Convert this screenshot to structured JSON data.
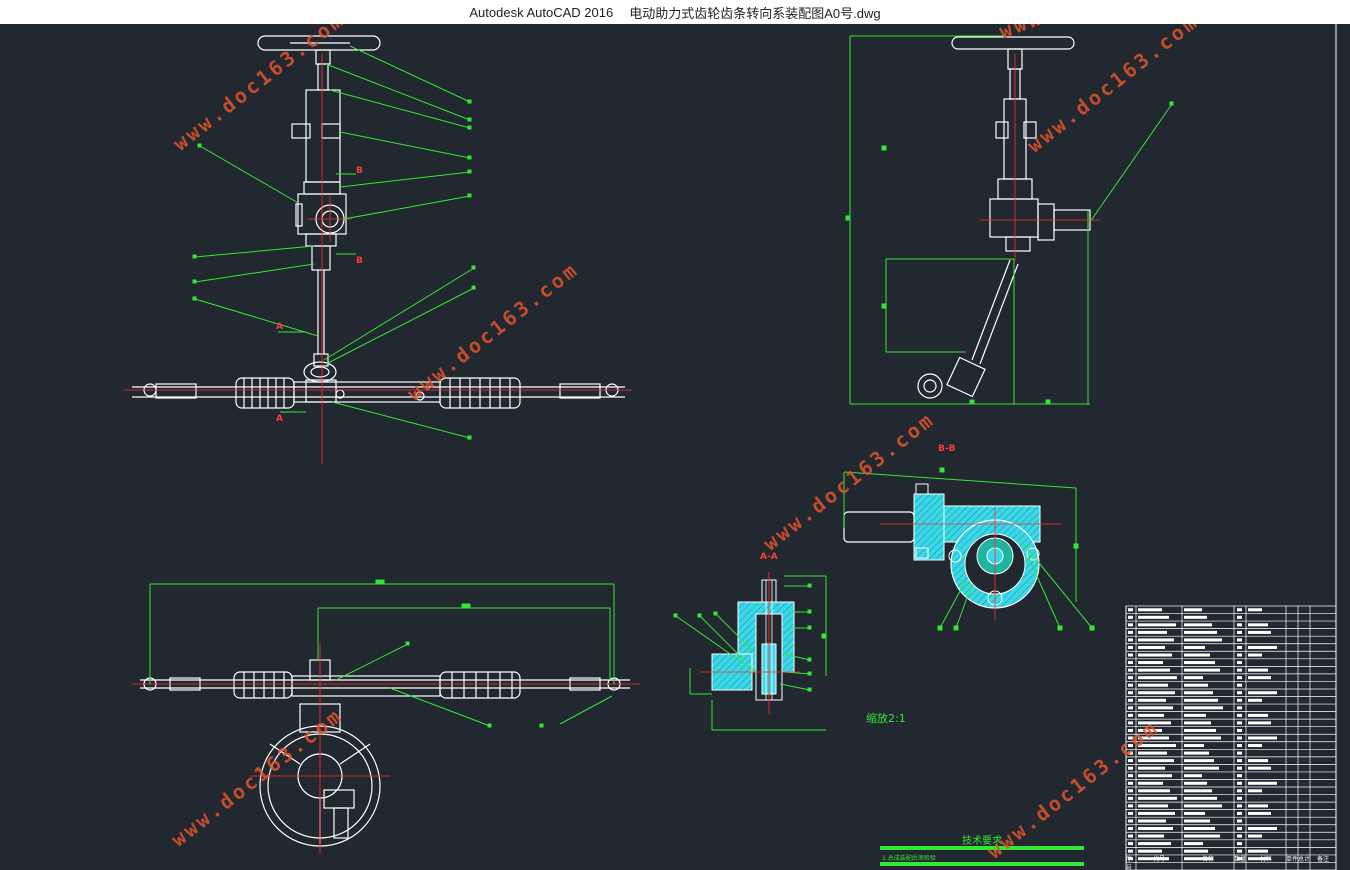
{
  "window": {
    "app_title": "Autodesk AutoCAD 2016",
    "file_name": "电动助力式齿轮齿条转向系装配图A0号.dwg"
  },
  "watermarks": [
    {
      "text": "www.doc163.com"
    },
    {
      "text": "www.doc163.com"
    },
    {
      "text": "www.doc163.com"
    },
    {
      "text": "www.doc163.com"
    },
    {
      "text": "www.doc163.com"
    },
    {
      "text": "www.doc163.com"
    },
    {
      "text": "www.doc163.com"
    }
  ],
  "drawing": {
    "scale_label": "缩放2:1",
    "tech_requirements_title": "技术要求",
    "tech_note": "1.总成装配后须检验",
    "view_labels": {
      "section_a": "A-A",
      "section_b": "B-B",
      "arrow_a": "A",
      "arrow_b": "B"
    },
    "colors": {
      "background": "#212830",
      "outline": "#ffffff",
      "leader": "#36e636",
      "centerline": "#ff3030",
      "section_fill": "#3ad7e6",
      "watermark": "#e0542c"
    }
  },
  "title_block": {
    "header": {
      "seq": "序号",
      "code": "代号",
      "name": "名称",
      "qty": "数量",
      "material": "材料",
      "unit_weight": "单件",
      "total_weight": "总计",
      "remark": "备注"
    },
    "rows": 34
  }
}
